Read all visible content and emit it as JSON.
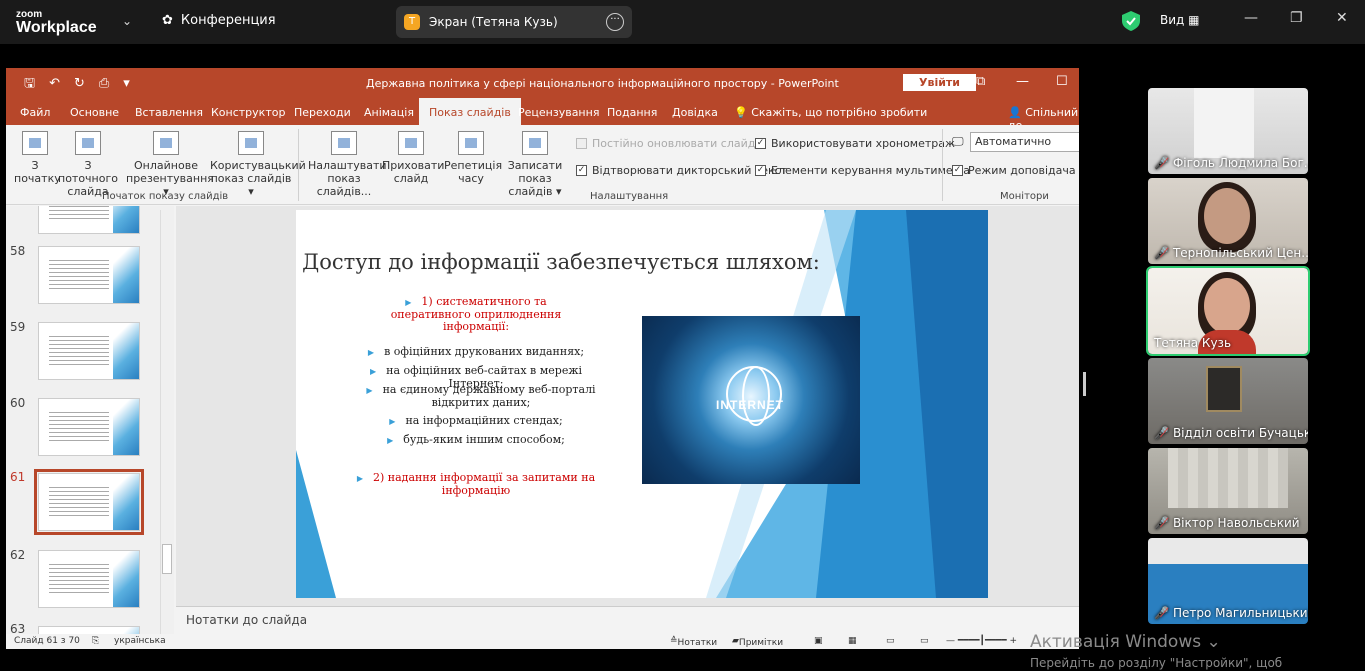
{
  "zoom": {
    "logo_top": "zoom",
    "logo_bottom": "Workplace",
    "meeting": "Конференция",
    "share": {
      "avatar": "T",
      "label": "Экран (Тетяна Кузь)"
    },
    "view": "Вид",
    "colors": {
      "bar": "#1a1a1a",
      "shield": "#2ecc71",
      "avatar": "#f5a623"
    }
  },
  "ppt": {
    "title": "Державна політика у сфері національного інформаційного простору  -  PowerPoint",
    "login": "Увійти",
    "tabs": [
      "Файл",
      "Основне",
      "Вставлення",
      "Конструктор",
      "Переходи",
      "Анімація",
      "Показ слайдів",
      "Рецензування",
      "Подання",
      "Довідка"
    ],
    "tell_me": "Скажіть, що потрібно зробити",
    "share": "Спільний до",
    "ribbon": {
      "from_start": [
        "З",
        "початку"
      ],
      "from_current": [
        "З поточного",
        "слайда"
      ],
      "online": [
        "Онлайнове",
        "презентування ▾"
      ],
      "custom": [
        "Користувацький",
        "показ слайдів ▾"
      ],
      "setup": [
        "Налаштувати",
        "показ слайдів..."
      ],
      "hide": [
        "Приховати",
        "слайд"
      ],
      "rehearse": [
        "Репетиція",
        "часу"
      ],
      "record": [
        "Записати показ",
        "слайдів ▾"
      ],
      "cb_keep_updated": "Постійно оновлювати слайди",
      "cb_narration": "Відтворювати дикторський текст",
      "cb_timings": "Використовувати хронометраж",
      "cb_media": "Елементи керування мультимедіа",
      "monitor_value": "Автоматично",
      "cb_presenter": "Режим доповідача",
      "group_start": "Початок показу слайдів",
      "group_setup": "Налаштування",
      "group_monitors": "Монітори"
    },
    "thumb_numbers": [
      "58",
      "59",
      "60",
      "61",
      "62",
      "63"
    ],
    "slide": {
      "heading": "Доступ до інформації забезпечується шляхом:",
      "p1": "1) систематичного та оперативного оприлюднення інформації:",
      "items": [
        "в офіційних друкованих виданнях;",
        "на офіційних веб-сайтах в мережі Інтернет;",
        "на єдиному державному веб-порталі відкритих даних;",
        "на інформаційних стендах;",
        "будь-яким іншим способом;"
      ],
      "p2": "2) надання інформації за запитами на інформацію",
      "image_text": "INTERNET"
    },
    "notes": "Нотатки до слайда",
    "status": {
      "slide": "Слайд 61 з 70",
      "lang": "українська",
      "notes": "Нотатки",
      "comments": "Примітки"
    }
  },
  "participants": [
    {
      "name": "Фіголь Людмила Бог...",
      "muted": true
    },
    {
      "name": "Тернопільський Цен...",
      "muted": true
    },
    {
      "name": "Тетяна Кузь",
      "muted": false
    },
    {
      "name": "Відділ освіти Бучацьк...",
      "muted": true
    },
    {
      "name": "Віктор Навольський",
      "muted": true
    },
    {
      "name": "Петро Магильницький",
      "muted": true
    }
  ],
  "watermark": {
    "line1": "Активація Windows",
    "line2": "Перейдіть до розділу \"Настройки\", щоб"
  }
}
